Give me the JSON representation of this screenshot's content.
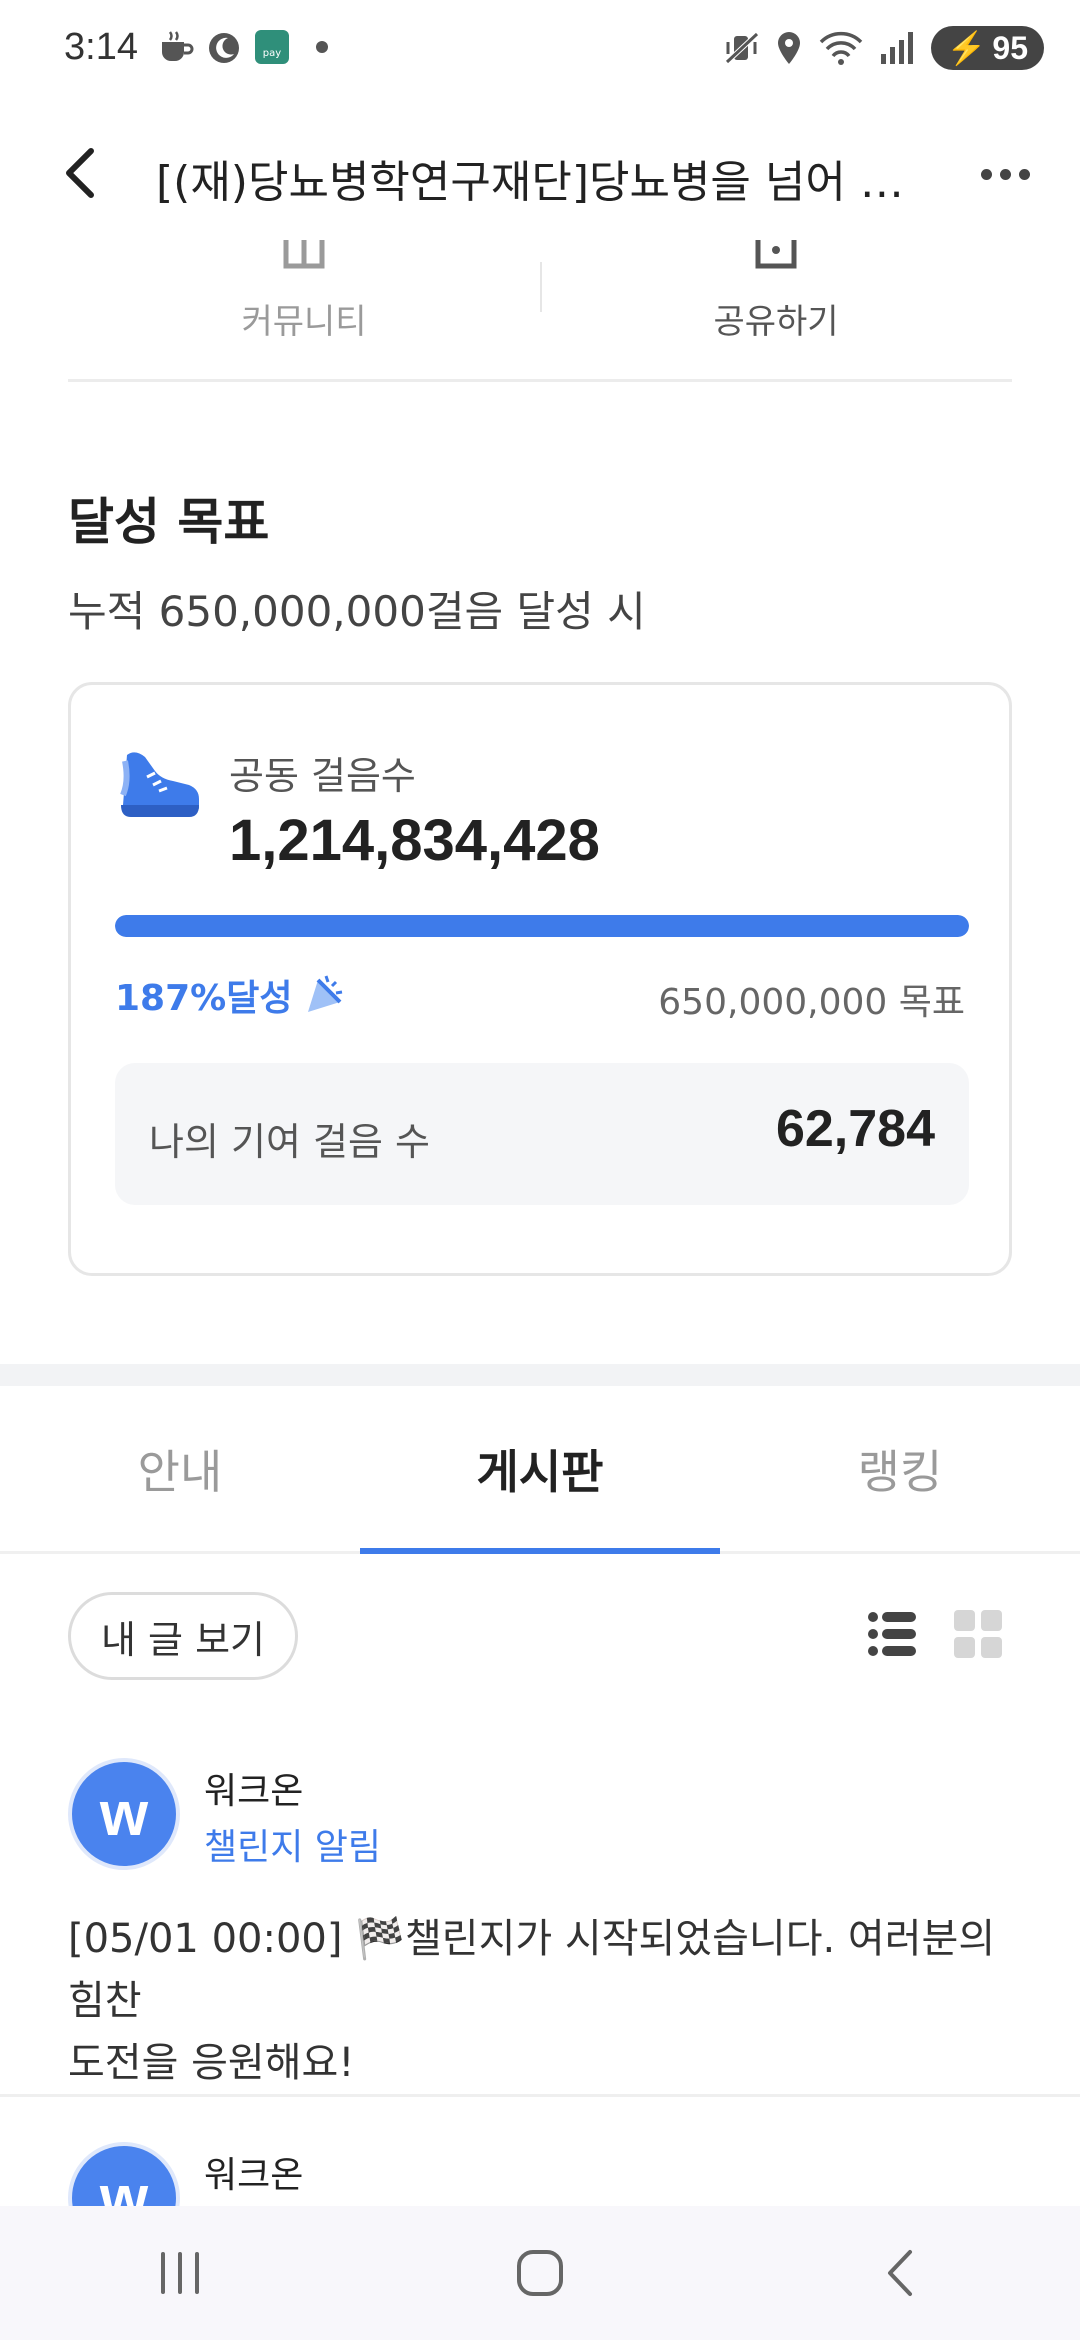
{
  "status_bar": {
    "time": "3:14",
    "battery": "95",
    "icons_left": [
      "coffee-icon",
      "moon-icon",
      "pay-app-icon",
      "dot-icon"
    ],
    "icons_right": [
      "mute-vibrate-icon",
      "location-icon",
      "wifi-icon",
      "signal-icon",
      "battery-icon"
    ]
  },
  "header": {
    "title": "[(재)당뇨병학연구재단]당뇨병을 넘어 …"
  },
  "actions": [
    {
      "label": "커뮤니티",
      "icon": "community-icon"
    },
    {
      "label": "공유하기",
      "icon": "share-icon"
    }
  ],
  "goal": {
    "title": "달성 목표",
    "subtitle": "누적 650,000,000걸음 달성 시"
  },
  "card": {
    "label": "공동 걸음수",
    "value": "1,214,834,428",
    "progress_fraction": 1.0,
    "achieved": "187%달성",
    "target": "650,000,000 목표",
    "contribution_label": "나의 기여 걸음 수",
    "contribution_value": "62,784",
    "colors": {
      "accent": "#3e7bea",
      "track": "#e7ecf7"
    }
  },
  "tabs": [
    {
      "label": "안내",
      "active": false
    },
    {
      "label": "게시판",
      "active": true
    },
    {
      "label": "랭킹",
      "active": false
    }
  ],
  "toolbar": {
    "my_posts": "내 글 보기",
    "view_modes": [
      "list-view-icon",
      "grid-view-icon"
    ],
    "active_view": "list"
  },
  "posts": [
    {
      "author": "워크온",
      "tag": "챌린지 알림",
      "avatar_letter": "w",
      "body_line1": "[05/01 00:00] 🏁챌린지가 시작되었습니다. 여러분의 힘찬",
      "body_line2": "도전을 응원해요!"
    },
    {
      "author": "워크온",
      "avatar_letter": "w"
    }
  ],
  "nav": [
    "recent-apps-icon",
    "home-icon",
    "back-icon"
  ]
}
